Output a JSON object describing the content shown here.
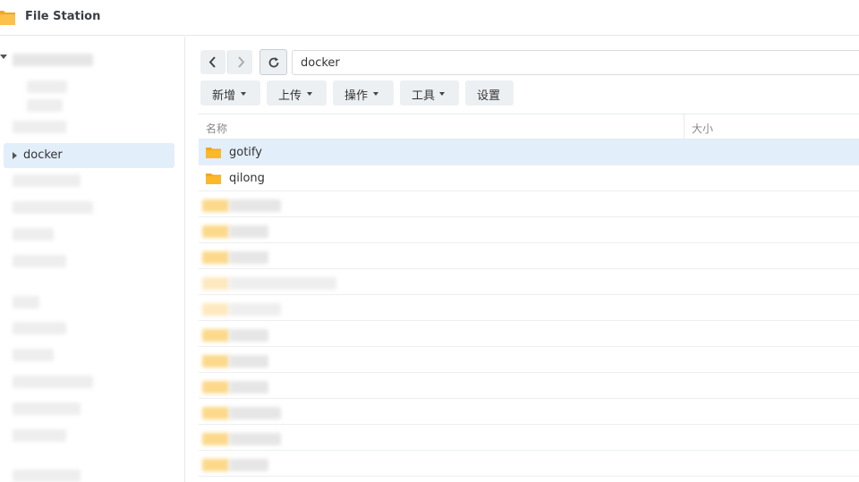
{
  "app": {
    "title": "File Station",
    "icon": "folder-app-icon"
  },
  "sidebar": {
    "selected_item": {
      "label": "docker"
    }
  },
  "toolbar": {
    "path": "docker",
    "buttons": [
      {
        "label": "新增",
        "dropdown": true
      },
      {
        "label": "上传",
        "dropdown": true
      },
      {
        "label": "操作",
        "dropdown": true
      },
      {
        "label": "工具",
        "dropdown": true
      },
      {
        "label": "设置",
        "dropdown": false
      }
    ]
  },
  "list": {
    "columns": {
      "name": "名称",
      "size": "大小"
    },
    "files": [
      {
        "name": "gotify",
        "type": "folder",
        "selected": true
      },
      {
        "name": "qilong",
        "type": "folder",
        "selected": false
      }
    ]
  },
  "colors": {
    "accent_selected": "#e3eefb",
    "folder": "#f5a623"
  }
}
